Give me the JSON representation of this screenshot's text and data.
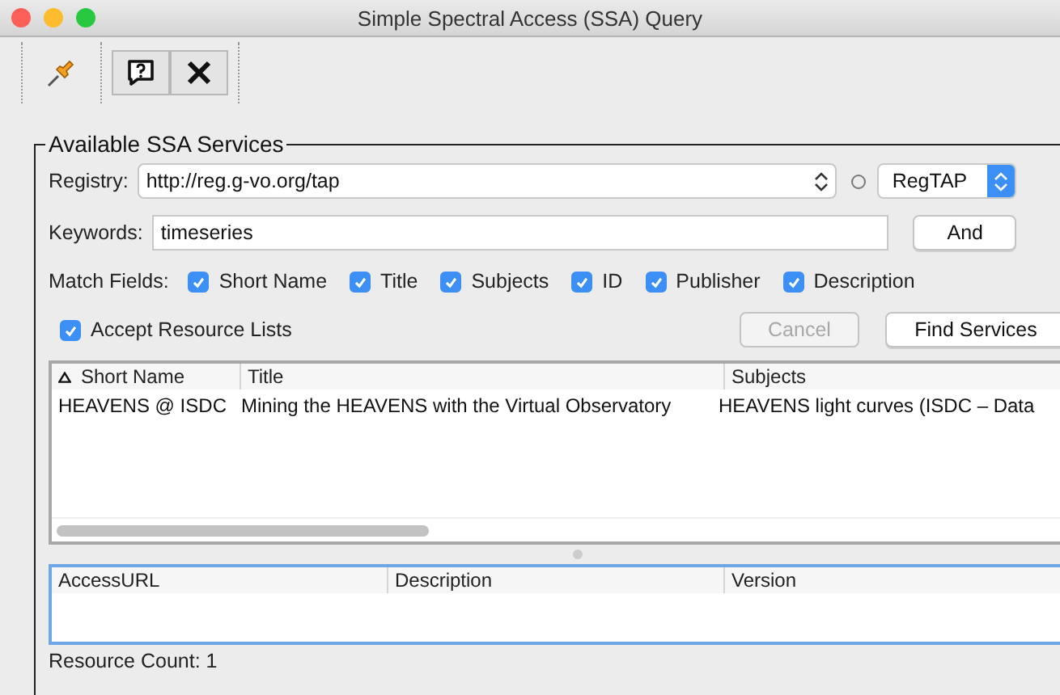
{
  "window": {
    "title": "Simple Spectral Access (SSA) Query"
  },
  "group": {
    "title": "Available SSA Services"
  },
  "registry": {
    "label": "Registry:",
    "value": "http://reg.g-vo.org/tap",
    "radio_selected": false,
    "protocol": "RegTAP"
  },
  "keywords": {
    "label": "Keywords:",
    "value": "timeseries",
    "mode_button": "And"
  },
  "match_fields": {
    "label": "Match Fields:",
    "options": [
      {
        "label": "Short Name",
        "checked": true
      },
      {
        "label": "Title",
        "checked": true
      },
      {
        "label": "Subjects",
        "checked": true
      },
      {
        "label": "ID",
        "checked": true
      },
      {
        "label": "Publisher",
        "checked": true
      },
      {
        "label": "Description",
        "checked": true
      }
    ]
  },
  "accept_resource_lists": {
    "label": "Accept Resource Lists",
    "checked": true
  },
  "buttons": [
    {
      "label": "Cancel",
      "disabled": true
    },
    {
      "label": "Find Services",
      "disabled": false
    }
  ],
  "services_table": {
    "columns": [
      "Short Name",
      "Title",
      "Subjects"
    ],
    "rows": [
      [
        "HEAVENS @ ISDC",
        "Mining the HEAVENS with the Virtual Observatory",
        "HEAVENS light curves (ISDC – Data"
      ]
    ]
  },
  "interfaces_table": {
    "columns": [
      "AccessURL",
      "Description",
      "Version"
    ]
  },
  "status_bar": "Resource Count: 1"
}
